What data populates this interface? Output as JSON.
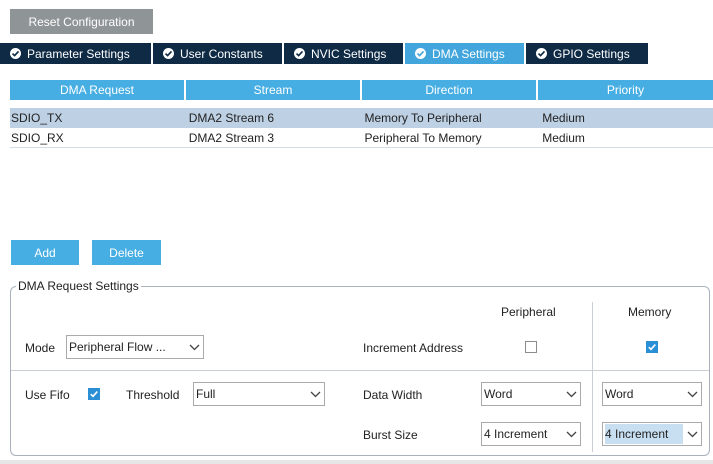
{
  "reset_label": "Reset Configuration",
  "tabs": [
    {
      "label": "Parameter Settings",
      "active": false
    },
    {
      "label": "User Constants",
      "active": false
    },
    {
      "label": "NVIC Settings",
      "active": false
    },
    {
      "label": "DMA Settings",
      "active": true
    },
    {
      "label": "GPIO Settings",
      "active": false
    }
  ],
  "table": {
    "headers": [
      "DMA Request",
      "Stream",
      "Direction",
      "Priority"
    ],
    "rows": [
      {
        "request": "SDIO_TX",
        "stream": "DMA2 Stream 6",
        "direction": "Memory To Peripheral",
        "priority": "Medium",
        "selected": true
      },
      {
        "request": "SDIO_RX",
        "stream": "DMA2 Stream 3",
        "direction": "Peripheral To Memory",
        "priority": "Medium",
        "selected": false
      }
    ]
  },
  "buttons": {
    "add": "Add",
    "delete": "Delete"
  },
  "settings": {
    "title": "DMA Request Settings",
    "col_peripheral": "Peripheral",
    "col_memory": "Memory",
    "mode_label": "Mode",
    "mode_value": "Peripheral Flow ...",
    "increment_label": "Increment Address",
    "increment_peripheral": false,
    "increment_memory": true,
    "use_fifo_label": "Use Fifo",
    "use_fifo": true,
    "threshold_label": "Threshold",
    "threshold_value": "Full",
    "data_width_label": "Data Width",
    "data_width_peripheral": "Word",
    "data_width_memory": "Word",
    "burst_label": "Burst Size",
    "burst_peripheral": "4 Increment",
    "burst_memory": "4 Increment"
  },
  "colors": {
    "accent": "#46aee2",
    "tab_dark": "#0e2a44",
    "selected_row": "#bdd0e4",
    "checkbox_on": "#2b8fd6"
  }
}
